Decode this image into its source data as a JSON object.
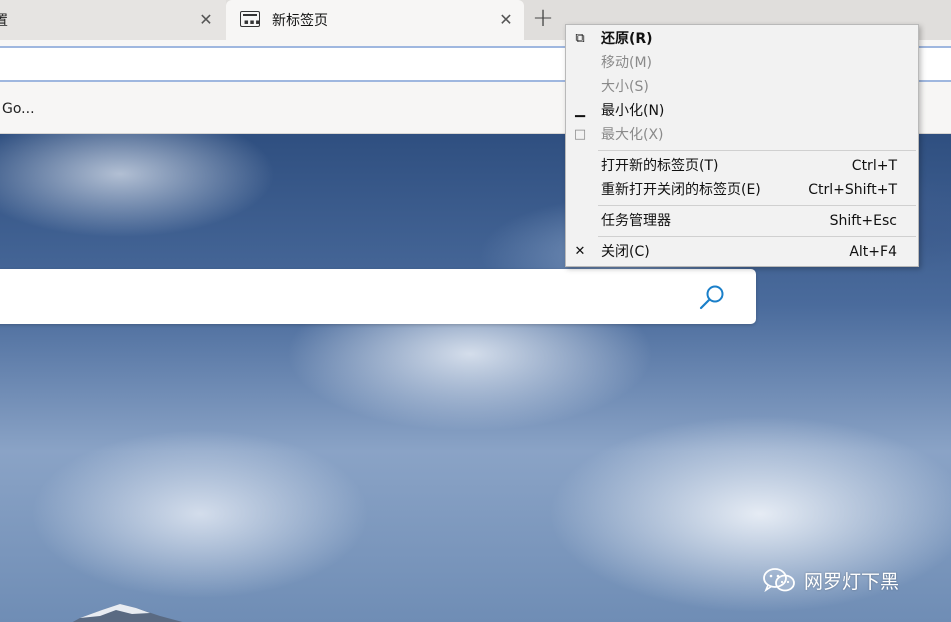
{
  "tabs": {
    "previous": {
      "label": "置",
      "close_glyph": "✕"
    },
    "active": {
      "label": "新标签页",
      "close_glyph": "✕"
    },
    "new_tab_glyph": "+"
  },
  "favorites_bar": {
    "item_label": "Go..."
  },
  "context_menu": {
    "items": [
      {
        "label": "还原(R)",
        "accel": "",
        "icon": "restore-icon",
        "glyph": "⧉",
        "state": "bold"
      },
      {
        "label": "移动(M)",
        "accel": "",
        "icon": "",
        "glyph": "",
        "state": "disabled"
      },
      {
        "label": "大小(S)",
        "accel": "",
        "icon": "",
        "glyph": "",
        "state": "disabled"
      },
      {
        "label": "最小化(N)",
        "accel": "",
        "icon": "minimize-icon",
        "glyph": "▁",
        "state": "normal"
      },
      {
        "label": "最大化(X)",
        "accel": "",
        "icon": "maximize-icon",
        "glyph": "□",
        "state": "disabled"
      },
      {
        "label": "打开新的标签页(T)",
        "accel": "Ctrl+T",
        "icon": "",
        "glyph": "",
        "state": "normal"
      },
      {
        "label": "重新打开关闭的标签页(E)",
        "accel": "Ctrl+Shift+T",
        "icon": "",
        "glyph": "",
        "state": "normal"
      },
      {
        "label": "任务管理器",
        "accel": "Shift+Esc",
        "icon": "",
        "glyph": "",
        "state": "normal"
      },
      {
        "label": "关闭(C)",
        "accel": "Alt+F4",
        "icon": "close-icon",
        "glyph": "✕",
        "state": "normal"
      }
    ]
  },
  "watermark": {
    "text": "网罗灯下黑",
    "icon": "wechat-icon"
  },
  "colors": {
    "accent": "#0078d4",
    "search_icon": "#1a7fc9",
    "menu_bg": "#f2f2f2",
    "disabled_text": "#8a8a8a"
  }
}
